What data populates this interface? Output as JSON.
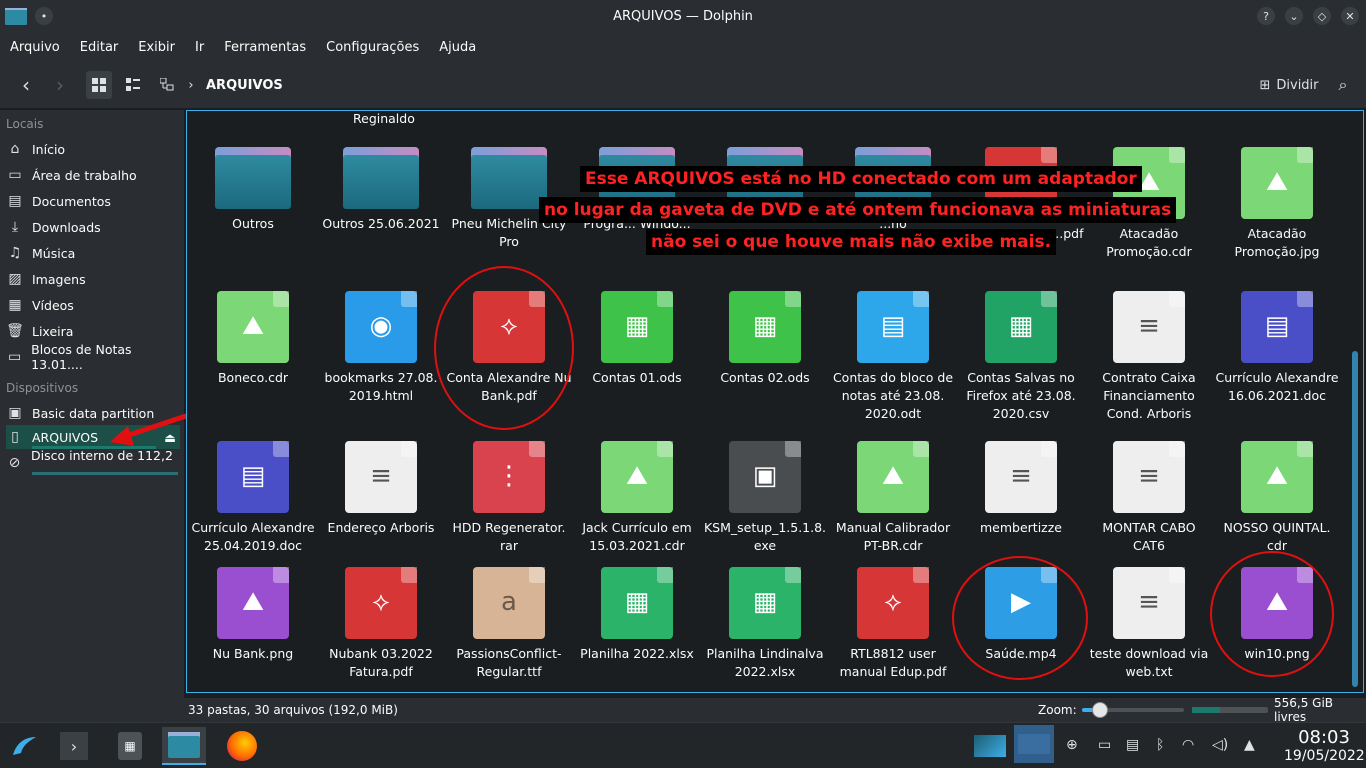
{
  "window": {
    "title": "ARQUIVOS — Dolphin",
    "help": "?"
  },
  "menu": [
    "Arquivo",
    "Editar",
    "Exibir",
    "Ir",
    "Ferramentas",
    "Configurações",
    "Ajuda"
  ],
  "toolbar": {
    "breadcrumb": "ARQUIVOS",
    "split_label": "Dividir"
  },
  "sidebar": {
    "locais_title": "Locais",
    "locais": [
      "Início",
      "Área de trabalho",
      "Documentos",
      "Downloads",
      "Música",
      "Imagens",
      "Vídeos",
      "Lixeira",
      "Blocos de Notas 13.01...."
    ],
    "dispositivos_title": "Dispositivos",
    "dispositivos": [
      "Basic data partition",
      "ARQUIVOS",
      "Disco interno de 112,2 ..."
    ]
  },
  "header_partial": "Reginaldo",
  "files": [
    {
      "name": "Outros",
      "kind": "folder"
    },
    {
      "name": "Outros 25.06.2021",
      "kind": "folder"
    },
    {
      "name": "Pneu Michelin City Pro",
      "kind": "folder"
    },
    {
      "name": "Progra... Windo...",
      "kind": "folder"
    },
    {
      "name": "",
      "kind": "folder"
    },
    {
      "name": "...no",
      "kind": "folder"
    },
    {
      "name": "em empresas ....pdf",
      "kind": "pdf"
    },
    {
      "name": "Atacadão Promoção.cdr",
      "kind": "image"
    },
    {
      "name": "Atacadão Promoção.jpg",
      "kind": "image"
    },
    {
      "name": "Boneco.cdr",
      "kind": "image"
    },
    {
      "name": "bookmarks 27.08. 2019.html",
      "kind": "html"
    },
    {
      "name": "Conta Alexandre Nu Bank.pdf",
      "kind": "pdf"
    },
    {
      "name": "Contas 01.ods",
      "kind": "sheet"
    },
    {
      "name": "Contas 02.ods",
      "kind": "sheet"
    },
    {
      "name": "Contas do bloco de notas até 23.08. 2020.odt",
      "kind": "odt"
    },
    {
      "name": "Contas Salvas no Firefox até 23.08. 2020.csv",
      "kind": "csv"
    },
    {
      "name": "Contrato Caixa Financiamento Cond. Arboris",
      "kind": "text"
    },
    {
      "name": "Currículo Alexandre 16.06.2021.doc",
      "kind": "doc"
    },
    {
      "name": "Currículo Alexandre 25.04.2019.doc",
      "kind": "doc"
    },
    {
      "name": "Endereço Arboris",
      "kind": "text"
    },
    {
      "name": "HDD Regenerator. rar",
      "kind": "rar"
    },
    {
      "name": "Jack Currículo em 15.03.2021.cdr",
      "kind": "image"
    },
    {
      "name": "KSM_setup_1.5.1.8. exe",
      "kind": "exe"
    },
    {
      "name": "Manual Calibrador PT-BR.cdr",
      "kind": "image"
    },
    {
      "name": "membertizze",
      "kind": "text"
    },
    {
      "name": "MONTAR CABO CAT6",
      "kind": "text"
    },
    {
      "name": "NOSSO QUINTAL. cdr",
      "kind": "image"
    },
    {
      "name": "Nu Bank.png",
      "kind": "png"
    },
    {
      "name": "Nubank 03.2022 Fatura.pdf",
      "kind": "pdf"
    },
    {
      "name": "PassionsConflict-Regular.ttf",
      "kind": "font"
    },
    {
      "name": "Planilha 2022.xlsx",
      "kind": "xlsx"
    },
    {
      "name": "Planilha Lindinalva 2022.xlsx",
      "kind": "xlsx"
    },
    {
      "name": "RTL8812 user manual Edup.pdf",
      "kind": "pdf"
    },
    {
      "name": "Saúde.mp4",
      "kind": "video"
    },
    {
      "name": "teste download via web.txt",
      "kind": "text"
    },
    {
      "name": "win10.png",
      "kind": "png"
    }
  ],
  "annotation": [
    "Esse ARQUIVOS está no HD conectado com um adaptador",
    "no lugar da gaveta de DVD e até ontem funcionava as miniaturas",
    "não sei o que houve mais não exibe mais."
  ],
  "status": {
    "summary": "33 pastas, 30 arquivos (192,0 MiB)",
    "zoom_label": "Zoom:",
    "free": "556,5 GiB livres",
    "zoom_level": 0.18
  },
  "clock": {
    "time": "08:03",
    "date": "19/05/2022"
  },
  "colors": {
    "accent": "#3daee9",
    "annotation": "#ff2222",
    "selection": "#1c4f48"
  }
}
